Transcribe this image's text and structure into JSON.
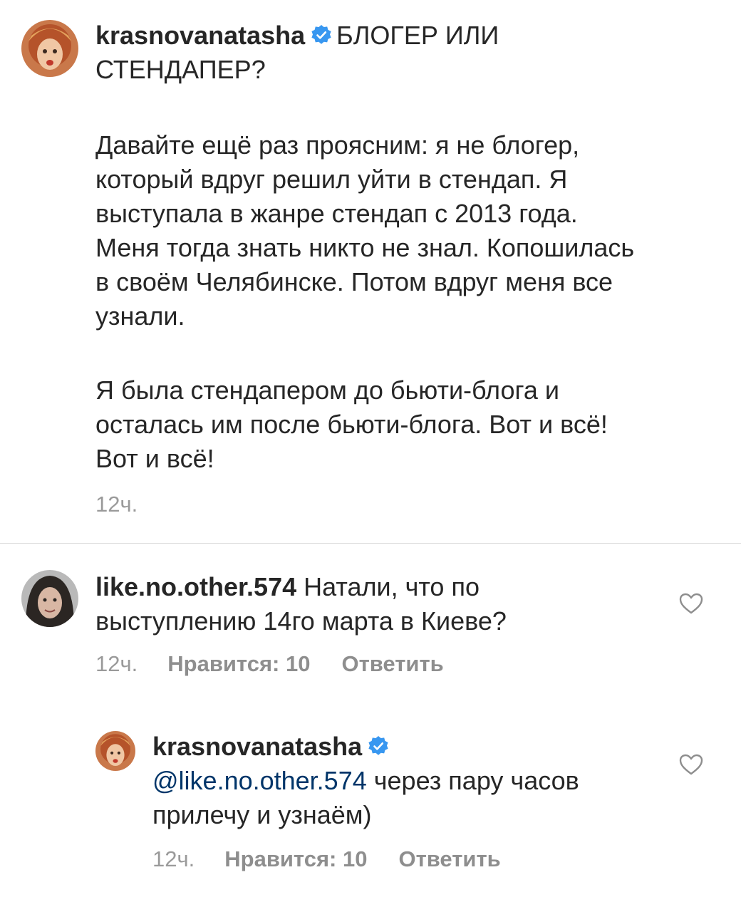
{
  "caption": {
    "username": "krasnovanatasha",
    "line1_text": "БЛОГЕР ИЛИ",
    "line2_text": "СТЕНДАПЕР?",
    "para1": [
      "Давайте ещё раз проясним: я не блогер,",
      "который вдруг решил уйти в стендап. Я",
      "выступала в жанре стендап с 2013 года.",
      "Меня тогда знать никто не знал. Копошилась",
      "в своём Челябинске. Потом вдруг меня все",
      "узнали."
    ],
    "para2": [
      "Я была стендапером до бьюти-блога и",
      "осталась им после бьюти-блога. Вот и всё!",
      "Вот и всё!"
    ],
    "time": "12ч."
  },
  "comment1": {
    "username": "like.no.other.574",
    "line1_text": "Натали, что по",
    "line2_text": "выступлению 14го марта в Киеве?",
    "time": "12ч.",
    "likes": "Нравится: 10",
    "reply": "Ответить"
  },
  "reply1": {
    "username": "krasnovanatasha",
    "mention": "@like.no.other.574",
    "line1_text": "через пару часов",
    "line2_text": "прилечу и узнаём)",
    "time": "12ч.",
    "likes": "Нравится: 10",
    "reply": "Ответить"
  },
  "colors": {
    "verified": "#3897f0",
    "mention": "#003569",
    "meta": "#8e8e8e",
    "divider": "#dbdbdb"
  },
  "icons": {
    "verified": "verified-badge-icon",
    "like": "heart-outline-icon"
  }
}
